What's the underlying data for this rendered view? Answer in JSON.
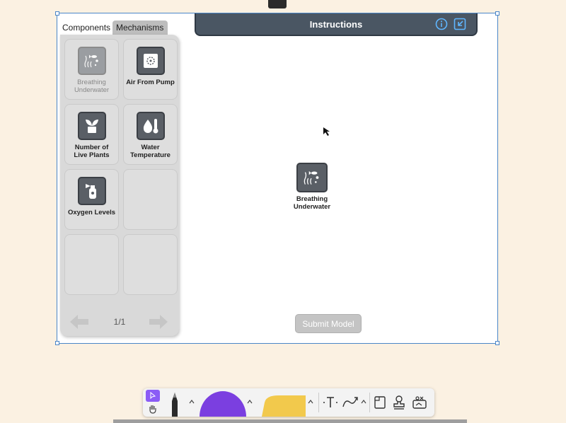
{
  "tabs": {
    "components": "Components",
    "mechanisms": "Mechanisms"
  },
  "instructions": {
    "title": "Instructions"
  },
  "components": [
    {
      "label_line1": "Breathing",
      "label_line2": "Underwater",
      "icon": "fish-bubbles-icon",
      "state": "used"
    },
    {
      "label_line1": "Air From Pump",
      "label_line2": "",
      "icon": "air-pump-icon",
      "state": "available"
    },
    {
      "label_line1": "Number of",
      "label_line2": "Live Plants",
      "icon": "plant-icon",
      "state": "available"
    },
    {
      "label_line1": "Water",
      "label_line2": "Temperature",
      "icon": "water-thermometer-icon",
      "state": "available"
    },
    {
      "label_line1": "Oxygen Levels",
      "label_line2": "",
      "icon": "oxygen-tank-icon",
      "state": "available"
    }
  ],
  "pager": {
    "page": "1/1"
  },
  "canvas": {
    "node_line1": "Breathing",
    "node_line2": "Underwater"
  },
  "submit_label": "Submit Model",
  "colors": {
    "tile": "#5a5f66",
    "header": "#4a5663",
    "selection": "#4a86c8",
    "pen_purple": "#7b3fe0",
    "highlighter": "#f2c94c"
  }
}
